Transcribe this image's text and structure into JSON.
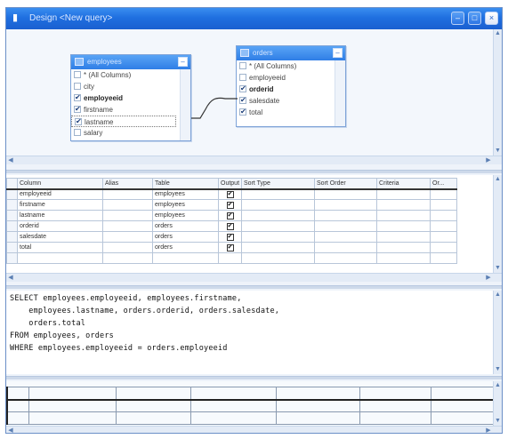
{
  "window": {
    "title": "Design <New query>",
    "buttons": [
      "minimize",
      "maximize",
      "close"
    ],
    "accent": "#1f6fe0"
  },
  "diagram": {
    "tables": [
      {
        "name": "employees",
        "rows": [
          {
            "label": "* (All Columns)",
            "checked": false,
            "bold": false
          },
          {
            "label": "city",
            "checked": false,
            "bold": false
          },
          {
            "label": "employeeid",
            "checked": true,
            "bold": true
          },
          {
            "label": "firstname",
            "checked": true,
            "bold": false
          },
          {
            "label": "lastname",
            "checked": true,
            "bold": false,
            "selected": true
          },
          {
            "label": "salary",
            "checked": false,
            "bold": false
          }
        ]
      },
      {
        "name": "orders",
        "rows": [
          {
            "label": "* (All Columns)",
            "checked": false,
            "bold": false
          },
          {
            "label": "employeeid",
            "checked": false,
            "bold": false
          },
          {
            "label": "orderid",
            "checked": true,
            "bold": true
          },
          {
            "label": "salesdate",
            "checked": true,
            "bold": false
          },
          {
            "label": "total",
            "checked": true,
            "bold": false
          }
        ]
      }
    ]
  },
  "grid": {
    "headers": [
      "Column",
      "Alias",
      "Table",
      "Output",
      "Sort Type",
      "Sort Order",
      "Criteria",
      "Or..."
    ],
    "rows": [
      {
        "column": "employeeid",
        "alias": "",
        "table": "employees",
        "output": true
      },
      {
        "column": "firstname",
        "alias": "",
        "table": "employees",
        "output": true
      },
      {
        "column": "lastname",
        "alias": "",
        "table": "employees",
        "output": true
      },
      {
        "column": "orderid",
        "alias": "",
        "table": "orders",
        "output": true
      },
      {
        "column": "salesdate",
        "alias": "",
        "table": "orders",
        "output": true
      },
      {
        "column": "total",
        "alias": "",
        "table": "orders",
        "output": true
      }
    ]
  },
  "sql": {
    "lines": [
      "SELECT employees.employeeid, employees.firstname,",
      "    employees.lastname, orders.orderid, orders.salesdate,",
      "    orders.total",
      "FROM employees, orders",
      "WHERE employees.employeeid = orders.employeeid"
    ]
  },
  "results": {
    "columns": 6,
    "rows": 3
  }
}
